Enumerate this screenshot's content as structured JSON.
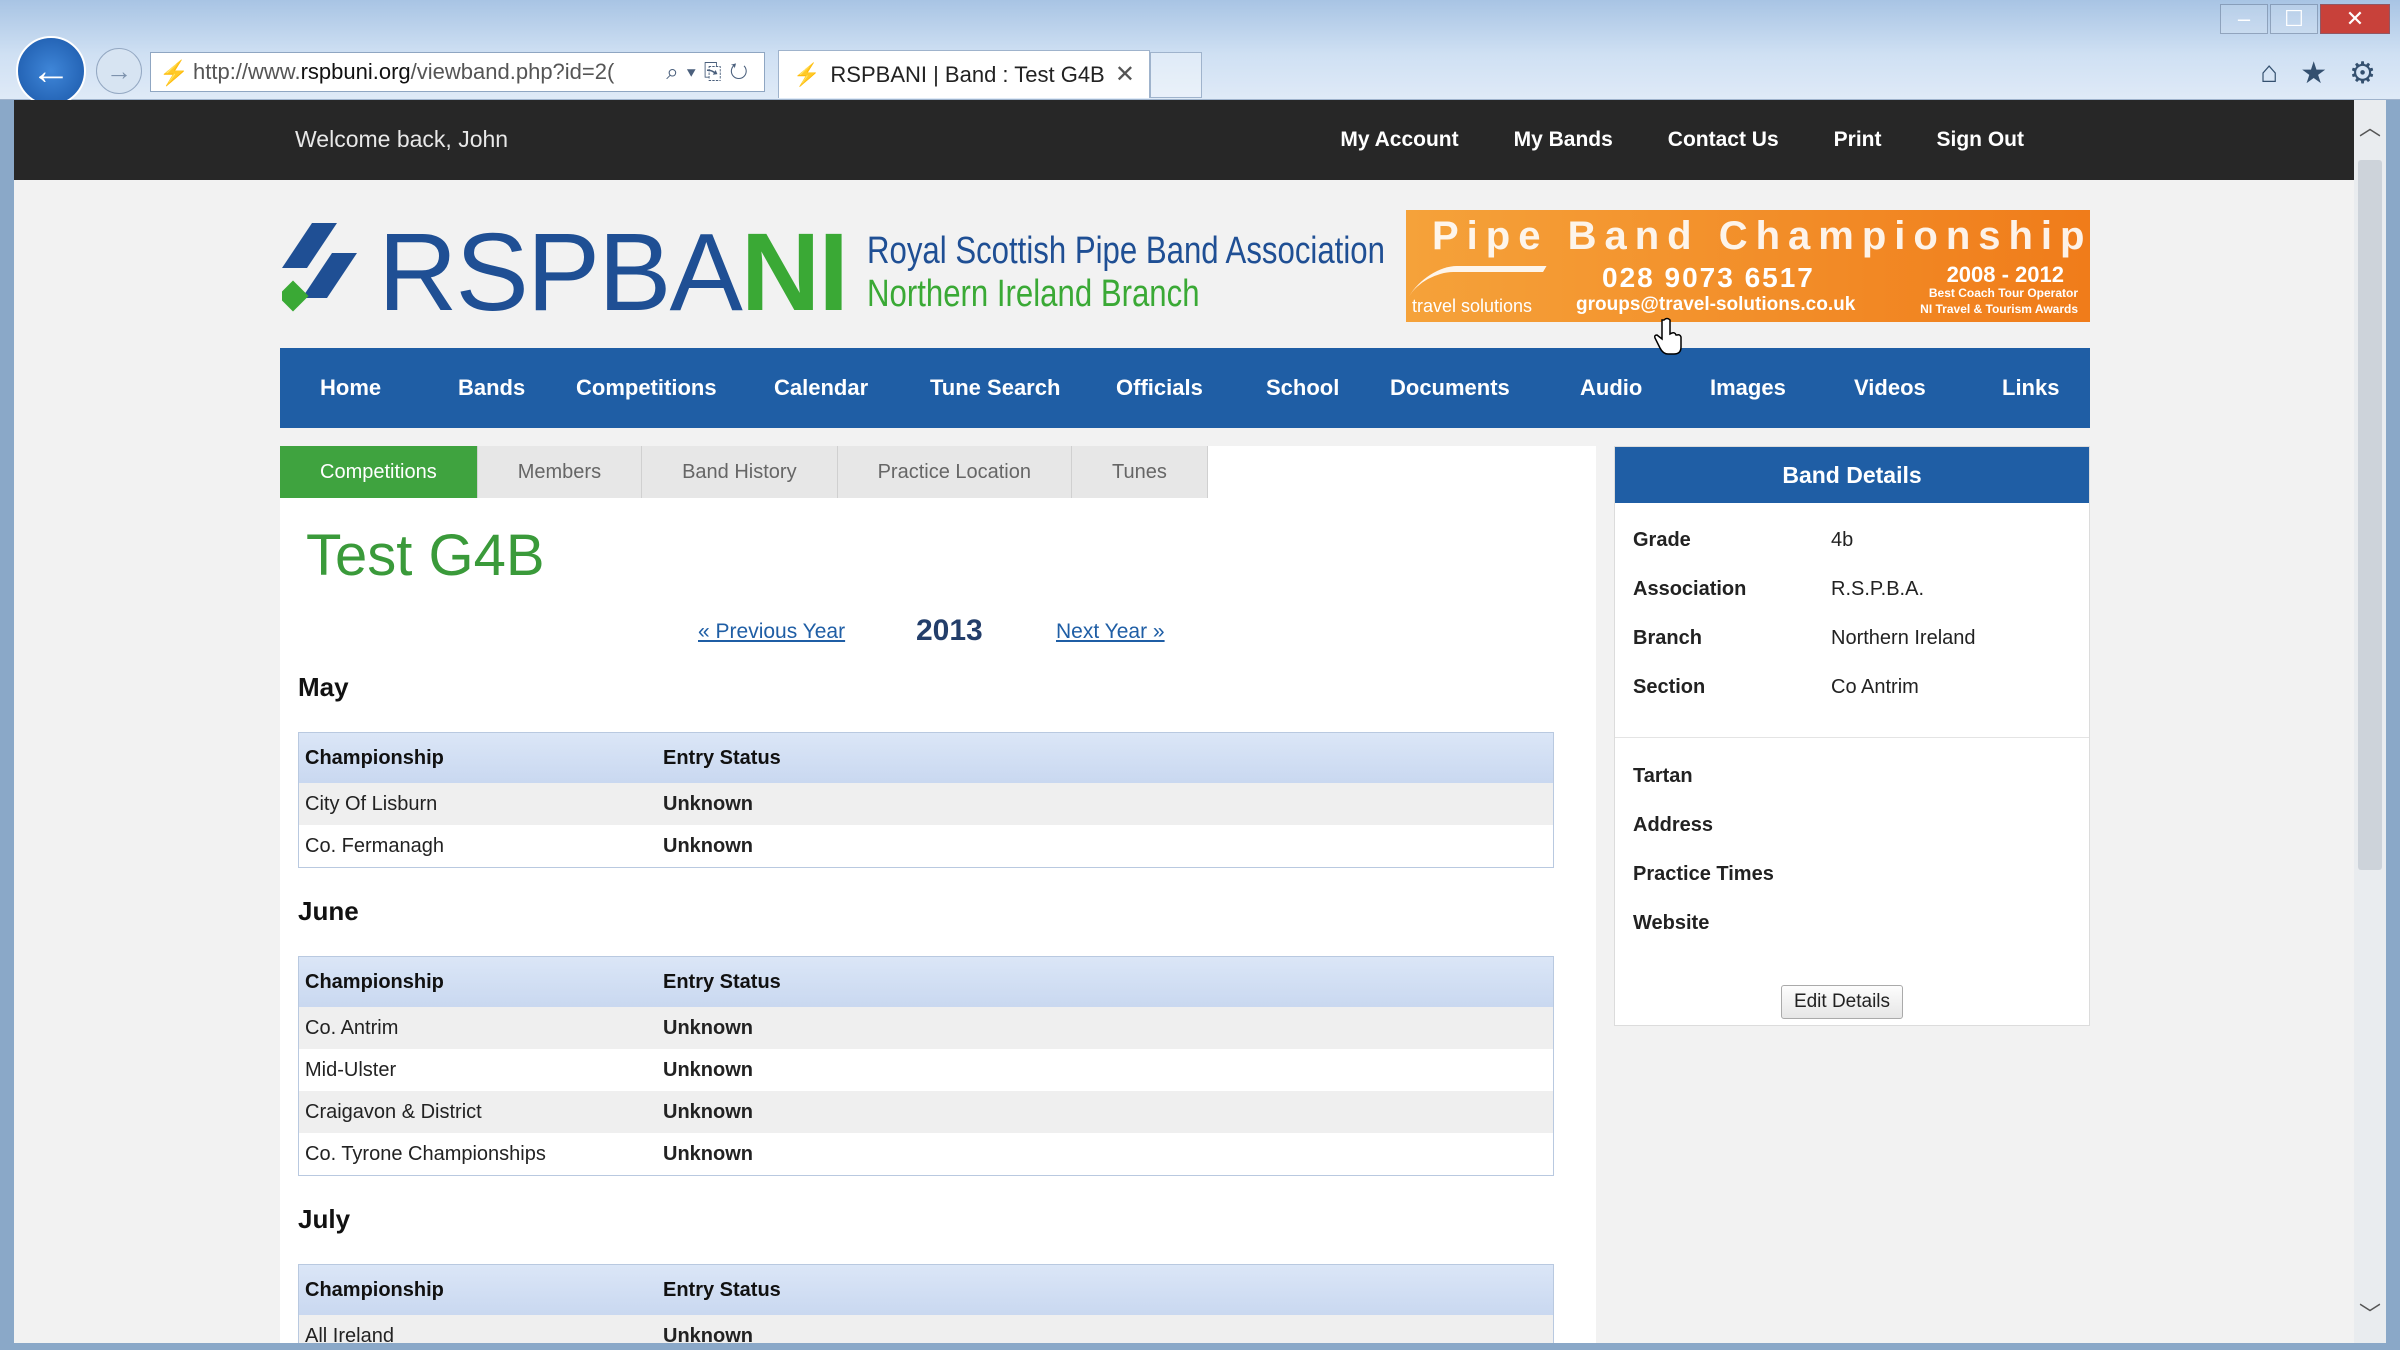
{
  "browser": {
    "url_prefix": "http://www.",
    "url_domain": "rspbuni.org",
    "url_rest": "/viewband.php?id=2(",
    "tab_title": "RSPBANI | Band : Test G4B"
  },
  "topbar": {
    "welcome": "Welcome back, John",
    "links": [
      "My Account",
      "My Bands",
      "Contact Us",
      "Print",
      "Sign Out"
    ]
  },
  "logo": {
    "word_blue": "RSPBA",
    "word_green": "NI",
    "line1": "Royal Scottish Pipe Band Association",
    "line2": "Northern Ireland Branch"
  },
  "banner": {
    "headline": "Pipe Band Championships!",
    "phone": "028 9073 6517",
    "email": "groups@travel-solutions.co.uk",
    "years": "2008 - 2012",
    "award1": "Best Coach Tour Operator",
    "award2": "NI Travel & Tourism Awards",
    "brand": "travel solutions"
  },
  "mainnav": [
    "Home",
    "Bands",
    "Competitions",
    "Calendar",
    "Tune Search",
    "Officials",
    "School",
    "Documents",
    "Audio",
    "Images",
    "Videos",
    "Links"
  ],
  "subtabs": [
    "Competitions",
    "Members",
    "Band History",
    "Practice Location",
    "Tunes"
  ],
  "band": {
    "title": "Test G4B",
    "prev_year": "« Previous Year",
    "year": "2013",
    "next_year": "Next Year »"
  },
  "table_headers": {
    "championship": "Championship",
    "entry_status": "Entry Status"
  },
  "months": [
    {
      "name": "May",
      "rows": [
        {
          "championship": "City Of Lisburn",
          "status": "Unknown"
        },
        {
          "championship": "Co. Fermanagh",
          "status": "Unknown"
        }
      ]
    },
    {
      "name": "June",
      "rows": [
        {
          "championship": "Co. Antrim",
          "status": "Unknown"
        },
        {
          "championship": "Mid-Ulster",
          "status": "Unknown"
        },
        {
          "championship": "Craigavon & District",
          "status": "Unknown"
        },
        {
          "championship": "Co. Tyrone Championships",
          "status": "Unknown"
        }
      ]
    },
    {
      "name": "July",
      "rows": [
        {
          "championship": "All Ireland",
          "status": "Unknown"
        }
      ]
    }
  ],
  "details": {
    "title": "Band Details",
    "fields": [
      {
        "label": "Grade",
        "value": "4b"
      },
      {
        "label": "Association",
        "value": "R.S.P.B.A."
      },
      {
        "label": "Branch",
        "value": "Northern Ireland"
      },
      {
        "label": "Section",
        "value": "Co Antrim"
      }
    ],
    "extra": [
      "Tartan",
      "Address",
      "Practice Times",
      "Website"
    ],
    "edit_button": "Edit Details"
  },
  "colors": {
    "nav_blue": "#1f5ea5",
    "brand_green": "#3aa935",
    "active_tab": "#3fa33f",
    "topbar": "#272727"
  }
}
